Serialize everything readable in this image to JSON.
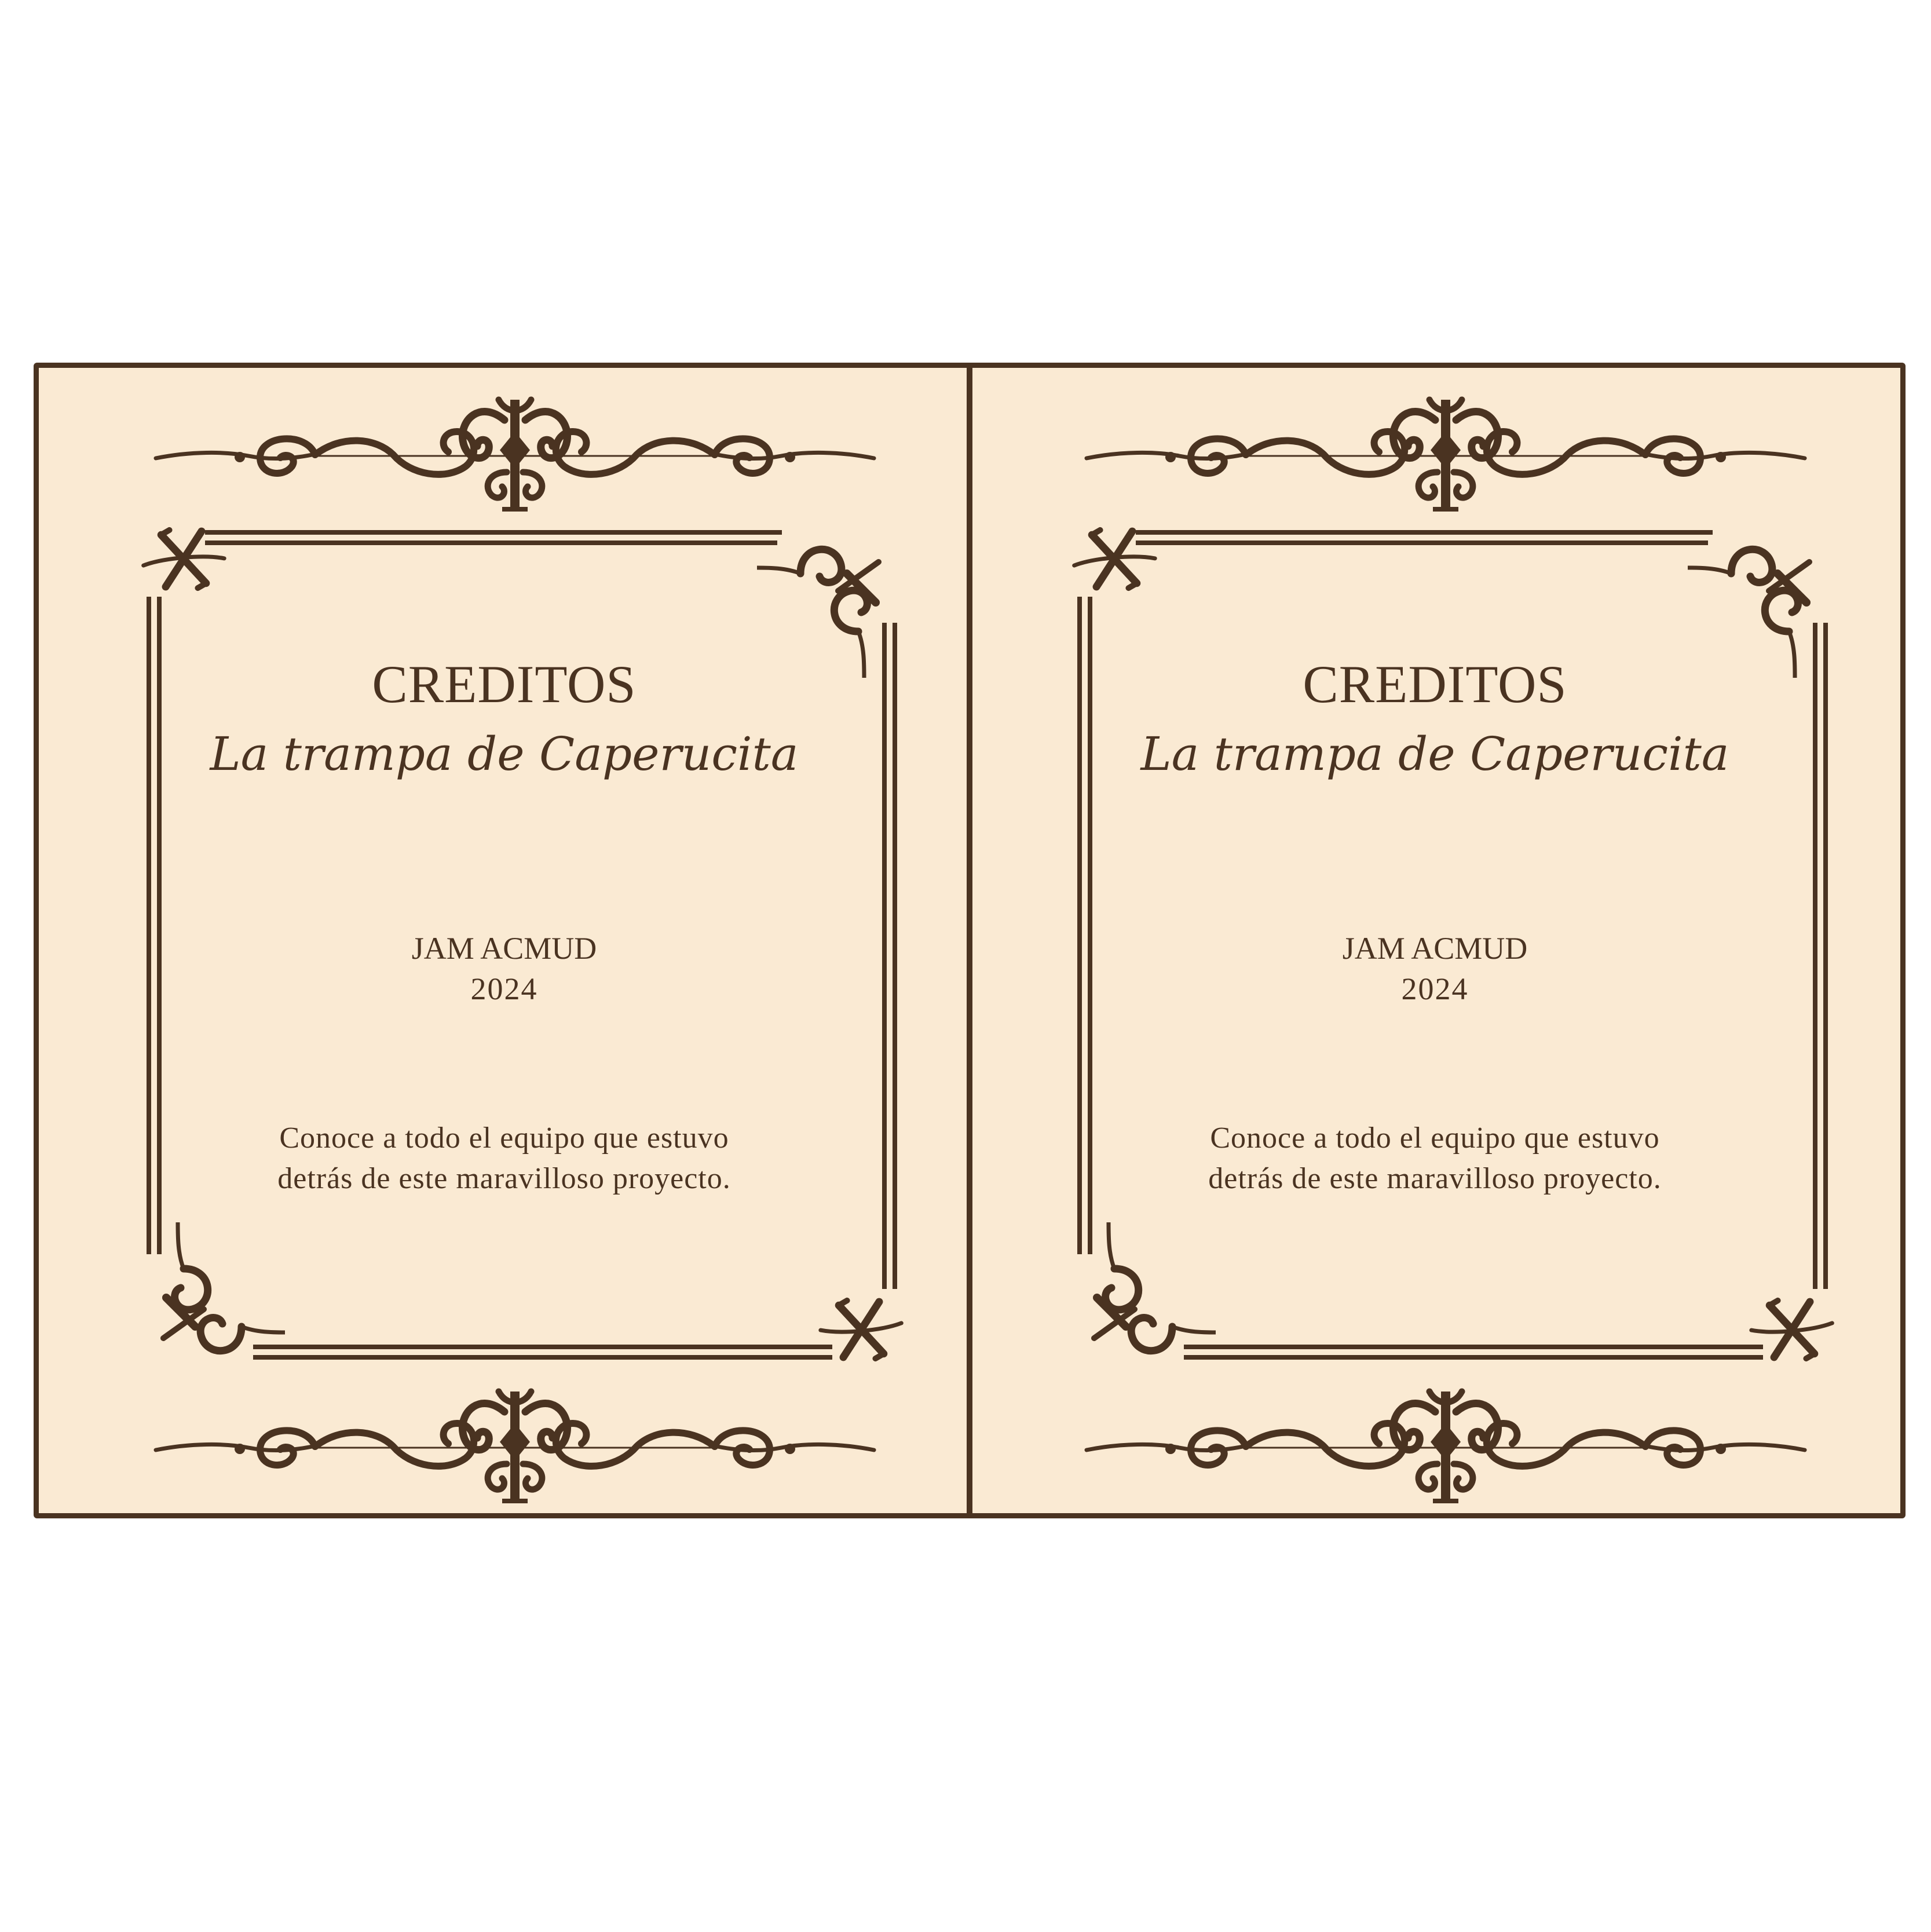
{
  "pages": [
    {
      "title": "CREDITOS",
      "subtitle": "La trampa de Caperucita",
      "author": "JAM ACMUD",
      "year": "2024",
      "blurb_line1": "Conoce a todo el equipo que estuvo",
      "blurb_line2": "detrás de este maravilloso proyecto."
    },
    {
      "title": "CREDITOS",
      "subtitle": "La trampa de Caperucita",
      "author": "JAM ACMUD",
      "year": "2024",
      "blurb_line1": "Conoce a todo el equipo que estuvo",
      "blurb_line2": "detrás de este maravilloso proyecto."
    }
  ],
  "colors": {
    "ink": "#4a3321",
    "paper": "#faead3",
    "background": "#ffffff"
  },
  "icons": [
    "flourish-divider-icon",
    "corner-swirl-icon",
    "double-frame-border"
  ]
}
